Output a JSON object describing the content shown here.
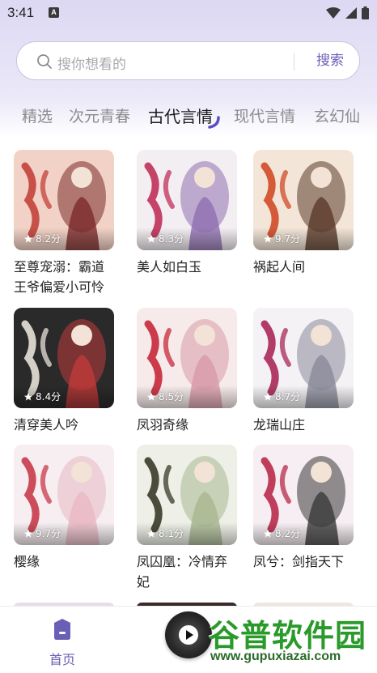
{
  "status_bar": {
    "time": "3:41",
    "notif_icon": "A"
  },
  "search": {
    "placeholder": "搜你想看的",
    "button_label": "搜索"
  },
  "tabs": [
    {
      "label": "精选"
    },
    {
      "label": "次元青春"
    },
    {
      "label": "古代言情",
      "active": true
    },
    {
      "label": "现代言情"
    },
    {
      "label": "玄幻仙"
    }
  ],
  "books": [
    {
      "title": "至尊宠溺：霸道王爷偏爱小可怜",
      "score": "8.2分",
      "colors": [
        "#f2d2c6",
        "#c2423a",
        "#7a2a2a"
      ]
    },
    {
      "title": "美人如白玉",
      "score": "8.3分",
      "colors": [
        "#f3eef2",
        "#c0305a",
        "#8f6fb0"
      ]
    },
    {
      "title": "祸起人间",
      "score": "9.7分",
      "colors": [
        "#f3e6d8",
        "#d04a28",
        "#5a3a2a"
      ]
    },
    {
      "title": "清穿美人吟",
      "score": "8.4分",
      "colors": [
        "#2a2a2a",
        "#e8e2d8",
        "#c03a3a"
      ]
    },
    {
      "title": "凤羽奇缘",
      "score": "8.5分",
      "colors": [
        "#f6eaea",
        "#c8283a",
        "#d89aa8"
      ]
    },
    {
      "title": "龙瑞山庄",
      "score": "8.7分",
      "colors": [
        "#f4f2f4",
        "#a82858",
        "#8a8a9a"
      ]
    },
    {
      "title": "樱缘",
      "score": "9.7分",
      "colors": [
        "#f6eef0",
        "#c83a4a",
        "#e8b8c4"
      ]
    },
    {
      "title": "凤囚凰：冷情弃妃",
      "score": "8.1分",
      "colors": [
        "#eef0e8",
        "#3a3a2a",
        "#a8b890"
      ]
    },
    {
      "title": "凤兮：剑指天下",
      "score": "8.2分",
      "colors": [
        "#f6eef2",
        "#b82a4a",
        "#3a3a3a"
      ]
    }
  ],
  "bottom_nav": {
    "home_label": "首页"
  },
  "watermark": {
    "text": "谷普软件园",
    "url": "www.gupuxiazai.com"
  }
}
